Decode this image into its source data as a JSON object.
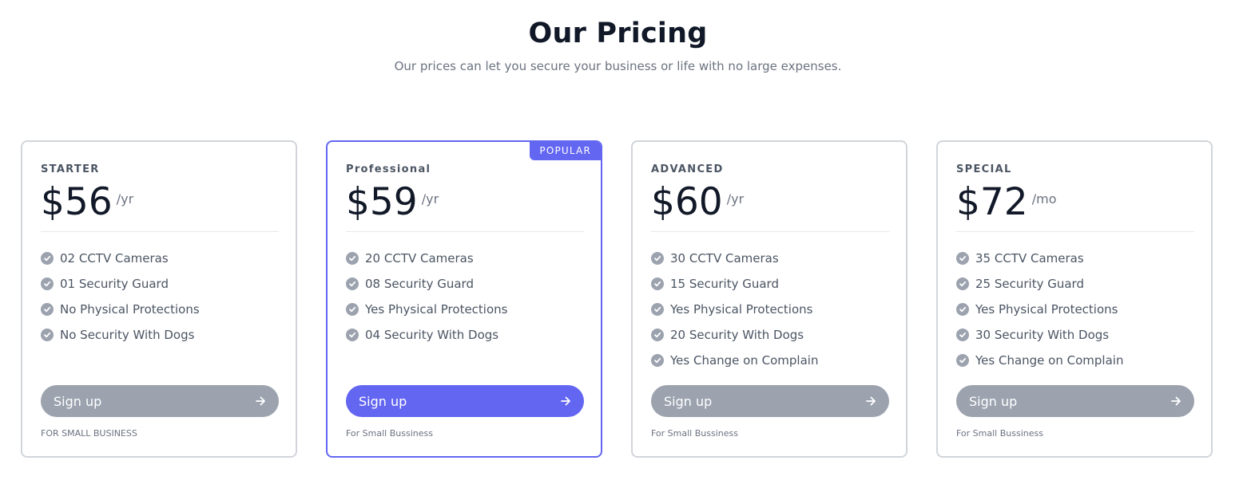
{
  "header": {
    "title": "Our Pricing",
    "subtitle": "Our prices can let you secure your business or life with no large expenses."
  },
  "accent_color": "#6366f1",
  "muted_button_color": "#9ca3af",
  "plans": [
    {
      "name": "STARTER",
      "price": "$56",
      "period": "/yr",
      "features": [
        "02 CCTV Cameras",
        "01 Security Guard",
        "No Physical Protections",
        "No Security With Dogs"
      ],
      "button_label": "Sign up",
      "footnote": "FOR SMALL BUSINESS"
    },
    {
      "name": "Professional",
      "badge": "POPULAR",
      "price": "$59",
      "period": "/yr",
      "features": [
        "20 CCTV Cameras",
        "08 Security Guard",
        "Yes Physical Protections",
        "04 Security With Dogs"
      ],
      "button_label": "Sign up",
      "footnote": "For Small Bussiness"
    },
    {
      "name": "ADVANCED",
      "price": "$60",
      "period": "/yr",
      "features": [
        "30 CCTV Cameras",
        "15 Security Guard",
        "Yes Physical Protections",
        "20 Security With Dogs",
        "Yes Change on Complain"
      ],
      "button_label": "Sign up",
      "footnote": "For Small Bussiness"
    },
    {
      "name": "SPECIAL",
      "price": "$72",
      "period": "/mo",
      "features": [
        "35 CCTV Cameras",
        "25 Security Guard",
        "Yes Physical Protections",
        "30 Security With Dogs",
        "Yes Change on Complain"
      ],
      "button_label": "Sign up",
      "footnote": "For Small Bussiness"
    }
  ],
  "icons": {
    "feature": "check-circle-icon",
    "button": "arrow-right-icon"
  }
}
